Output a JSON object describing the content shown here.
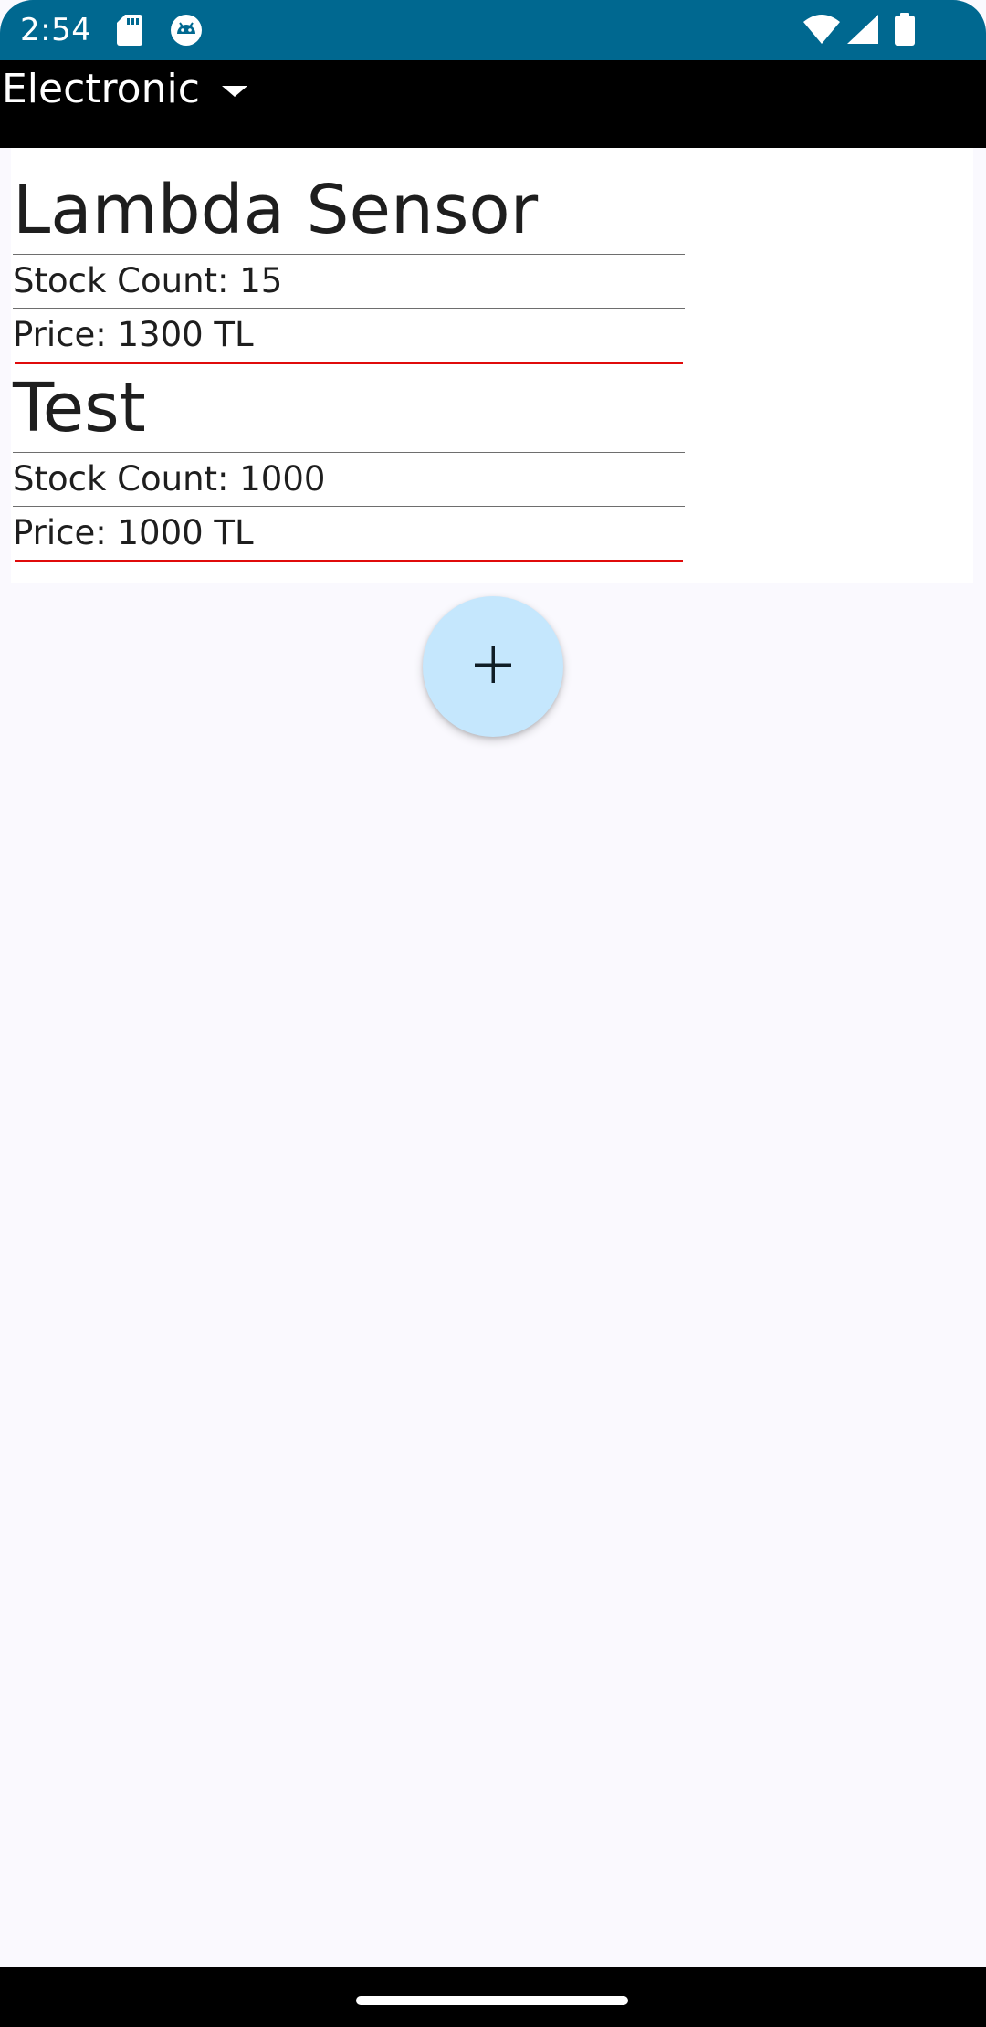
{
  "status_bar": {
    "time": "2:54",
    "icons": [
      "sd-card-icon",
      "android-debug-icon",
      "wifi-icon",
      "cell-signal-icon",
      "battery-icon"
    ],
    "background": "#006890"
  },
  "category_spinner": {
    "selected": "Electronic"
  },
  "products": [
    {
      "name": "Lambda Sensor",
      "stock_text": "Stock Count: 15",
      "price_text": "Price: 1300 TL"
    },
    {
      "name": "Test",
      "stock_text": "Stock Count: 1000",
      "price_text": "Price: 1000 TL"
    }
  ],
  "fab": {
    "icon": "plus-icon",
    "color": "#c5e7fd"
  },
  "colors": {
    "accent_divider": "#e00b0b",
    "background": "#faf9fe"
  }
}
